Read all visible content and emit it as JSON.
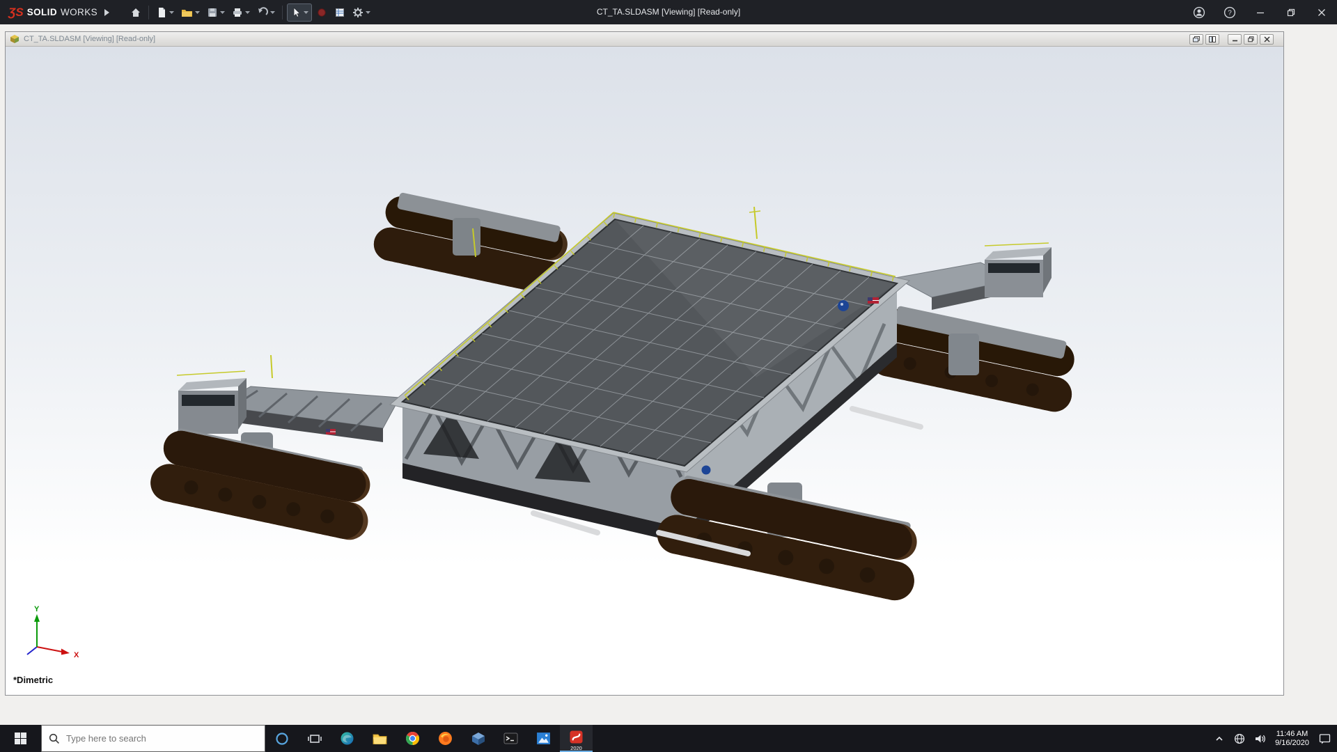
{
  "titlebar": {
    "brand_logo": "ƷS",
    "brand_name_bold": "SOLID",
    "brand_name_light": "WORKS",
    "title": "CT_TA.SLDASM [Viewing] [Read-only]",
    "help_glyph": "?",
    "toolbar_icons": [
      "home",
      "new-document",
      "open",
      "save",
      "print",
      "undo",
      "select-arrow",
      "record-macro",
      "design-binder",
      "options-gear"
    ],
    "window_controls": [
      "account",
      "help",
      "minimize",
      "maximize",
      "close"
    ]
  },
  "document_window": {
    "title": "CT_TA.SLDASM [Viewing] [Read-only]",
    "window_controls": [
      "cascade",
      "tile",
      "minimize",
      "restore",
      "close"
    ]
  },
  "viewport": {
    "view_orientation": "*Dimetric",
    "triad": {
      "x": "X",
      "y": "Y"
    }
  },
  "taskbar": {
    "search_placeholder": "Type here to search",
    "pinned_apps": [
      "cortana",
      "task-view",
      "edge",
      "file-explorer",
      "chrome",
      "firefox",
      "edrawings",
      "terminal",
      "photos",
      "solidworks-2020"
    ],
    "solidworks_version": "2020",
    "tray": [
      "hidden-icons",
      "network",
      "volume",
      "clock",
      "action-center"
    ],
    "clock_time": "11:46 AM",
    "clock_date": "9/16/2020"
  },
  "colors": {
    "titlebar_bg": "#1f2126",
    "brand_red": "#d6311f",
    "viewport_gradient_top": "#dce1e9",
    "viewport_gradient_bottom": "#ffffff",
    "taskbar_bg": "#16171c",
    "track_brown": "#4a3019",
    "structure_gray": "#9aa0a6",
    "triad_x_color": "#cc1111",
    "triad_y_color": "#0a9a0a"
  }
}
